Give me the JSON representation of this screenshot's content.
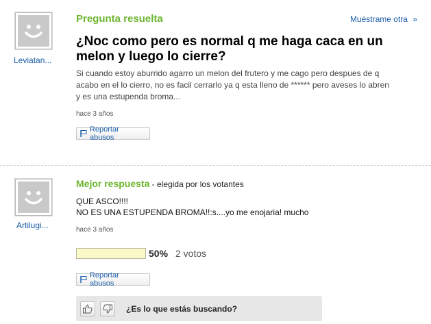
{
  "question": {
    "header": "Pregunta resuelta",
    "show_more": "Muéstrame otra",
    "show_more_arrow": "»",
    "user": "Leviatan...",
    "title": "¿Noc como pero es normal q me haga caca en un melon y luego lo cierre?",
    "body_line1": "Si cuando estoy aburrido agarro un melon del frutero y me cago pero despues de q",
    "body_line2": "acabo en el lo cierro, no es facil cerrarlo ya q esta lleno de ****** pero aveses lo abren",
    "body_line3": "y es una estupenda broma...",
    "time": "hace 3 años",
    "report": "Reportar abusos"
  },
  "best_answer": {
    "header": "Mejor respuesta",
    "chosen_by": " - elegida por los votantes",
    "user": "Artilugi...",
    "text_line1": "QUE ASCO!!!!",
    "text_line2": "NO ES UNA ESTUPENDA BROMA!!:s....yo me enojaria! mucho",
    "time": "hace 3 años",
    "vote_percent_label": "50%",
    "vote_fraction": 0.5,
    "votes_label": "2 votos",
    "report": "Reportar abusos",
    "rate_question": "¿Es lo que estás buscando?"
  },
  "colors": {
    "accent_green": "#6cb52d",
    "link_blue": "#1a5ea8",
    "vote_bar_fill": "#fbf9c6"
  },
  "icons": [
    "avatar-smiley-icon",
    "flag-icon",
    "thumbs-up-icon",
    "thumbs-down-icon"
  ]
}
